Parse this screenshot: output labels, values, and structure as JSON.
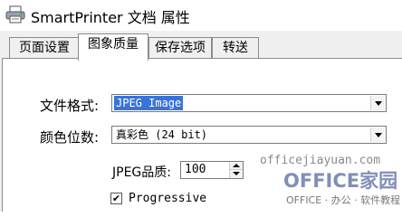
{
  "window": {
    "title": "SmartPrinter 文档 属性",
    "icon": "printer-icon"
  },
  "tabs": [
    {
      "label": "页面设置",
      "active": false
    },
    {
      "label": "图象质量",
      "active": true
    },
    {
      "label": "保存选项",
      "active": false
    },
    {
      "label": "转送",
      "active": false
    }
  ],
  "form": {
    "file_format": {
      "label": "文件格式:",
      "value": "JPEG Image"
    },
    "color_depth": {
      "label": "颜色位数:",
      "value": "真彩色 (24 bit)"
    },
    "jpeg_quality": {
      "label": "JPEG品质:",
      "value": "100"
    },
    "progressive": {
      "label": "Progressive",
      "checked": true,
      "check_mark": "✔"
    }
  },
  "watermark": {
    "url": "officejiayuan.com",
    "brand": "OFFICE家园",
    "tagline": "OFFICE · 办公 · 软件教程"
  },
  "colors": {
    "selection": "#3874d8",
    "watermark_brand": "#6c7cab"
  }
}
